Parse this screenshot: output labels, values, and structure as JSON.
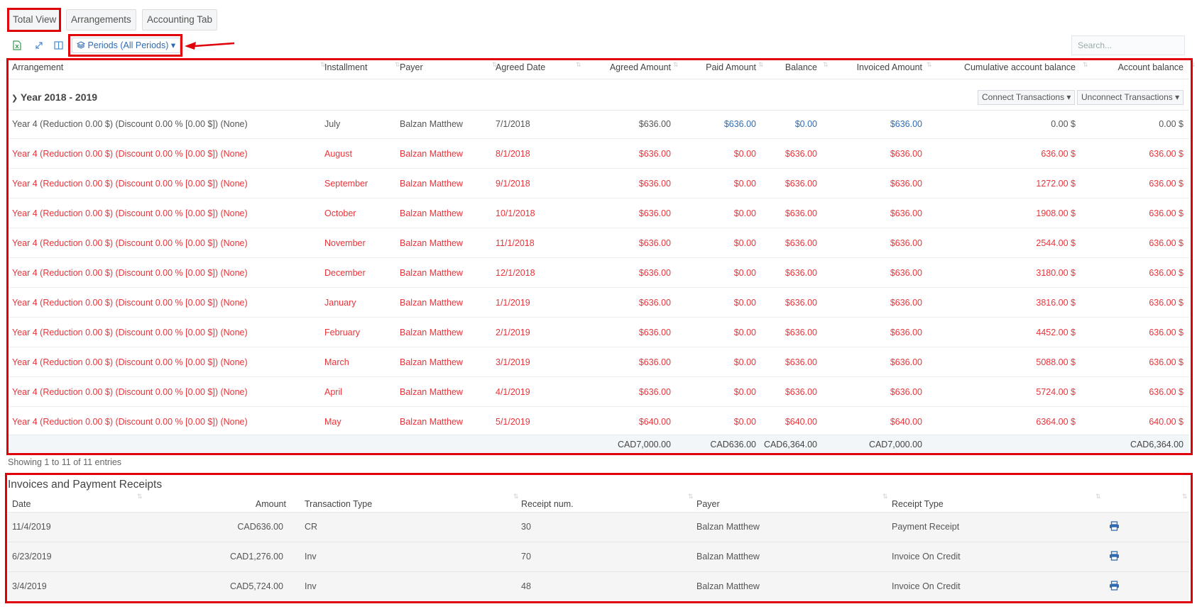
{
  "tabs": [
    "Total View",
    "Arrangements",
    "Accounting Tab"
  ],
  "toolbar": {
    "export_icon": "excel-export-icon",
    "expand_icon": "expand-icon",
    "columns_icon": "columns-icon",
    "periods_label": "Periods (All Periods)",
    "search_placeholder": "Search..."
  },
  "main_table": {
    "headers": [
      "Arrangement",
      "Installment",
      "Payer",
      "Agreed Date",
      "Agreed Amount",
      "Paid Amount",
      "Balance",
      "Invoiced Amount",
      "Cumulative account balance",
      "Account balance"
    ],
    "group_title": "Year 2018 - 2019",
    "connect_label": "Connect Transactions",
    "unconnect_label": "Unconnect Transactions",
    "rows": [
      {
        "arrangement": "Year 4 (Reduction 0.00 $) (Discount 0.00 % [0.00 $]) (None)",
        "installment": "July",
        "payer": "Balzan Matthew",
        "agreed_date": "7/1/2018",
        "agreed_amount": "$636.00",
        "paid_amount": "$636.00",
        "balance": "$0.00",
        "invoiced_amount": "$636.00",
        "cumulative": "0.00 $",
        "account_balance": "0.00 $",
        "status": "normal"
      },
      {
        "arrangement": "Year 4 (Reduction 0.00 $) (Discount 0.00 % [0.00 $]) (None)",
        "installment": "August",
        "payer": "Balzan Matthew",
        "agreed_date": "8/1/2018",
        "agreed_amount": "$636.00",
        "paid_amount": "$0.00",
        "balance": "$636.00",
        "invoiced_amount": "$636.00",
        "cumulative": "636.00 $",
        "account_balance": "636.00 $",
        "status": "overdue"
      },
      {
        "arrangement": "Year 4 (Reduction 0.00 $) (Discount 0.00 % [0.00 $]) (None)",
        "installment": "September",
        "payer": "Balzan Matthew",
        "agreed_date": "9/1/2018",
        "agreed_amount": "$636.00",
        "paid_amount": "$0.00",
        "balance": "$636.00",
        "invoiced_amount": "$636.00",
        "cumulative": "1272.00 $",
        "account_balance": "636.00 $",
        "status": "overdue"
      },
      {
        "arrangement": "Year 4 (Reduction 0.00 $) (Discount 0.00 % [0.00 $]) (None)",
        "installment": "October",
        "payer": "Balzan Matthew",
        "agreed_date": "10/1/2018",
        "agreed_amount": "$636.00",
        "paid_amount": "$0.00",
        "balance": "$636.00",
        "invoiced_amount": "$636.00",
        "cumulative": "1908.00 $",
        "account_balance": "636.00 $",
        "status": "overdue"
      },
      {
        "arrangement": "Year 4 (Reduction 0.00 $) (Discount 0.00 % [0.00 $]) (None)",
        "installment": "November",
        "payer": "Balzan Matthew",
        "agreed_date": "11/1/2018",
        "agreed_amount": "$636.00",
        "paid_amount": "$0.00",
        "balance": "$636.00",
        "invoiced_amount": "$636.00",
        "cumulative": "2544.00 $",
        "account_balance": "636.00 $",
        "status": "overdue"
      },
      {
        "arrangement": "Year 4 (Reduction 0.00 $) (Discount 0.00 % [0.00 $]) (None)",
        "installment": "December",
        "payer": "Balzan Matthew",
        "agreed_date": "12/1/2018",
        "agreed_amount": "$636.00",
        "paid_amount": "$0.00",
        "balance": "$636.00",
        "invoiced_amount": "$636.00",
        "cumulative": "3180.00 $",
        "account_balance": "636.00 $",
        "status": "overdue"
      },
      {
        "arrangement": "Year 4 (Reduction 0.00 $) (Discount 0.00 % [0.00 $]) (None)",
        "installment": "January",
        "payer": "Balzan Matthew",
        "agreed_date": "1/1/2019",
        "agreed_amount": "$636.00",
        "paid_amount": "$0.00",
        "balance": "$636.00",
        "invoiced_amount": "$636.00",
        "cumulative": "3816.00 $",
        "account_balance": "636.00 $",
        "status": "overdue"
      },
      {
        "arrangement": "Year 4 (Reduction 0.00 $) (Discount 0.00 % [0.00 $]) (None)",
        "installment": "February",
        "payer": "Balzan Matthew",
        "agreed_date": "2/1/2019",
        "agreed_amount": "$636.00",
        "paid_amount": "$0.00",
        "balance": "$636.00",
        "invoiced_amount": "$636.00",
        "cumulative": "4452.00 $",
        "account_balance": "636.00 $",
        "status": "overdue"
      },
      {
        "arrangement": "Year 4 (Reduction 0.00 $) (Discount 0.00 % [0.00 $]) (None)",
        "installment": "March",
        "payer": "Balzan Matthew",
        "agreed_date": "3/1/2019",
        "agreed_amount": "$636.00",
        "paid_amount": "$0.00",
        "balance": "$636.00",
        "invoiced_amount": "$636.00",
        "cumulative": "5088.00 $",
        "account_balance": "636.00 $",
        "status": "overdue"
      },
      {
        "arrangement": "Year 4 (Reduction 0.00 $) (Discount 0.00 % [0.00 $]) (None)",
        "installment": "April",
        "payer": "Balzan Matthew",
        "agreed_date": "4/1/2019",
        "agreed_amount": "$636.00",
        "paid_amount": "$0.00",
        "balance": "$636.00",
        "invoiced_amount": "$636.00",
        "cumulative": "5724.00 $",
        "account_balance": "636.00 $",
        "status": "overdue"
      },
      {
        "arrangement": "Year 4 (Reduction 0.00 $) (Discount 0.00 % [0.00 $]) (None)",
        "installment": "May",
        "payer": "Balzan Matthew",
        "agreed_date": "5/1/2019",
        "agreed_amount": "$640.00",
        "paid_amount": "$0.00",
        "balance": "$640.00",
        "invoiced_amount": "$640.00",
        "cumulative": "6364.00 $",
        "account_balance": "640.00 $",
        "status": "overdue"
      }
    ],
    "totals": {
      "agreed_amount": "CAD7,000.00",
      "paid_amount": "CAD636.00",
      "balance": "CAD6,364.00",
      "invoiced_amount": "CAD7,000.00",
      "account_balance": "CAD6,364.00"
    },
    "entries_text": "Showing 1 to 11 of 11 entries"
  },
  "receipts": {
    "title": "Invoices and Payment Receipts",
    "headers": [
      "Date",
      "Amount",
      "Transaction Type",
      "Receipt num.",
      "Payer",
      "Receipt Type"
    ],
    "rows": [
      {
        "date": "11/4/2019",
        "amount": "CAD636.00",
        "type": "CR",
        "receipt_num": "30",
        "payer": "Balzan Matthew",
        "receipt_type": "Payment Receipt",
        "action_icon": "print-icon"
      },
      {
        "date": "6/23/2019",
        "amount": "CAD1,276.00",
        "type": "Inv",
        "receipt_num": "70",
        "payer": "Balzan Matthew",
        "receipt_type": "Invoice On Credit",
        "action_icon": "print-icon"
      },
      {
        "date": "3/4/2019",
        "amount": "CAD5,724.00",
        "type": "Inv",
        "receipt_num": "48",
        "payer": "Balzan Matthew",
        "receipt_type": "Invoice On Credit",
        "action_icon": "print-icon"
      }
    ]
  },
  "colors": {
    "overdue": "#e8343a",
    "link": "#2e6bb3",
    "annotation": "#e0000a"
  }
}
